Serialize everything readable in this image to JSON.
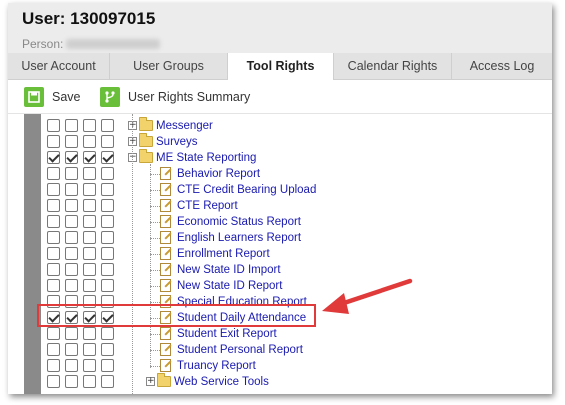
{
  "header": {
    "title": "User: 130097015",
    "person_label": "Person:"
  },
  "tabs": [
    {
      "label": "User Account",
      "active": false
    },
    {
      "label": "User Groups",
      "active": false
    },
    {
      "label": "Tool Rights",
      "active": true
    },
    {
      "label": "Calendar Rights",
      "active": false
    },
    {
      "label": "Access Log",
      "active": false
    }
  ],
  "toolbar": {
    "save_label": "Save",
    "save_icon": "save-icon",
    "summary_label": "User Rights Summary",
    "summary_icon": "branch-icon"
  },
  "tree": {
    "rows": [
      {
        "label": "Messenger",
        "type": "folder",
        "expander": "+",
        "level": 0,
        "checks": [
          false,
          false,
          false,
          false
        ]
      },
      {
        "label": "Surveys",
        "type": "folder",
        "expander": "+",
        "level": 0,
        "checks": [
          false,
          false,
          false,
          false
        ]
      },
      {
        "label": "ME State Reporting",
        "type": "folder",
        "expander": "-",
        "level": 0,
        "checks": [
          true,
          true,
          true,
          true
        ]
      },
      {
        "label": "Behavior Report",
        "type": "doc",
        "level": 1,
        "checks": [
          false,
          false,
          false,
          false
        ]
      },
      {
        "label": "CTE Credit Bearing Upload",
        "type": "doc",
        "level": 1,
        "checks": [
          false,
          false,
          false,
          false
        ]
      },
      {
        "label": "CTE Report",
        "type": "doc",
        "level": 1,
        "checks": [
          false,
          false,
          false,
          false
        ]
      },
      {
        "label": "Economic Status Report",
        "type": "doc",
        "level": 1,
        "checks": [
          false,
          false,
          false,
          false
        ]
      },
      {
        "label": "English Learners Report",
        "type": "doc",
        "level": 1,
        "checks": [
          false,
          false,
          false,
          false
        ]
      },
      {
        "label": "Enrollment Report",
        "type": "doc",
        "level": 1,
        "checks": [
          false,
          false,
          false,
          false
        ]
      },
      {
        "label": "New State ID Import",
        "type": "doc",
        "level": 1,
        "checks": [
          false,
          false,
          false,
          false
        ]
      },
      {
        "label": "New State ID Report",
        "type": "doc",
        "level": 1,
        "checks": [
          false,
          false,
          false,
          false
        ]
      },
      {
        "label": "Special Education Report",
        "type": "doc",
        "level": 1,
        "checks": [
          false,
          false,
          false,
          false
        ]
      },
      {
        "label": "Student Daily Attendance",
        "type": "doc",
        "level": 1,
        "checks": [
          true,
          true,
          true,
          true
        ],
        "highlighted": true
      },
      {
        "label": "Student Exit Report",
        "type": "doc",
        "level": 1,
        "checks": [
          false,
          false,
          false,
          false
        ]
      },
      {
        "label": "Student Personal Report",
        "type": "doc",
        "level": 1,
        "checks": [
          false,
          false,
          false,
          false
        ]
      },
      {
        "label": "Truancy Report",
        "type": "doc",
        "level": 1,
        "checks": [
          false,
          false,
          false,
          false
        ]
      },
      {
        "label": "Web Service Tools",
        "type": "folder",
        "expander": "+",
        "level": 1,
        "checks": [
          false,
          false,
          false,
          false
        ]
      }
    ]
  },
  "colors": {
    "link": "#1a1ab0",
    "highlight_box": "#e03a3a",
    "arrow": "#e03a3a",
    "toolbar_icon": "#6abf3a"
  }
}
